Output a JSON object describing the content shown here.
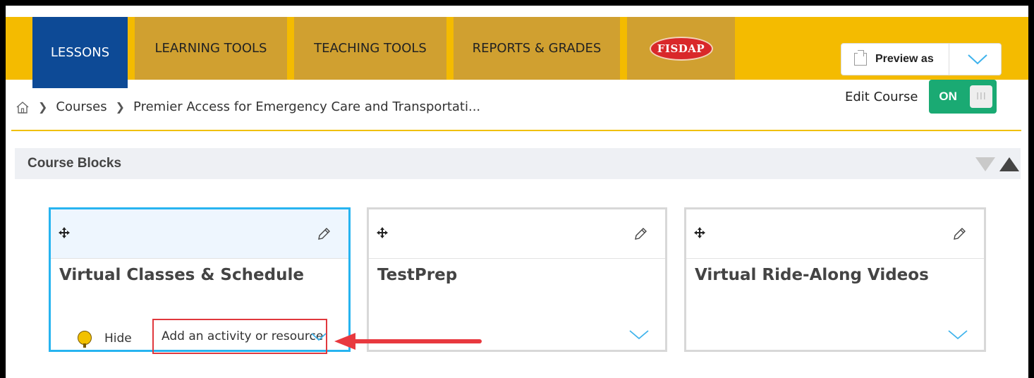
{
  "nav": {
    "tabs": [
      {
        "label": "LESSONS",
        "active": true
      },
      {
        "label": "LEARNING TOOLS",
        "active": false
      },
      {
        "label": "TEACHING TOOLS",
        "active": false
      },
      {
        "label": "REPORTS & GRADES",
        "active": false
      }
    ],
    "logo_text": "FISDAP",
    "preview_label": "Preview as"
  },
  "breadcrumb": {
    "items": [
      "Courses",
      "Premier Access for Emergency Care and Transportati..."
    ]
  },
  "edit_course": {
    "label": "Edit Course",
    "toggle_label": "ON",
    "toggle_knob": "III"
  },
  "course_blocks": {
    "title": "Course Blocks",
    "blocks": [
      {
        "title": "Virtual Classes & Schedule",
        "selected": true
      },
      {
        "title": "TestPrep",
        "selected": false
      },
      {
        "title": "Virtual Ride-Along Videos",
        "selected": false
      }
    ],
    "hide_label": "Hide",
    "add_activity_label": "Add an activity or resource"
  },
  "colors": {
    "topbar": "#f4bb00",
    "tab": "#d0a030",
    "active_tab": "#0d4a96",
    "toggle_on": "#1aaa73",
    "selected_border": "#27b4f0",
    "highlight": "#e0383d"
  }
}
